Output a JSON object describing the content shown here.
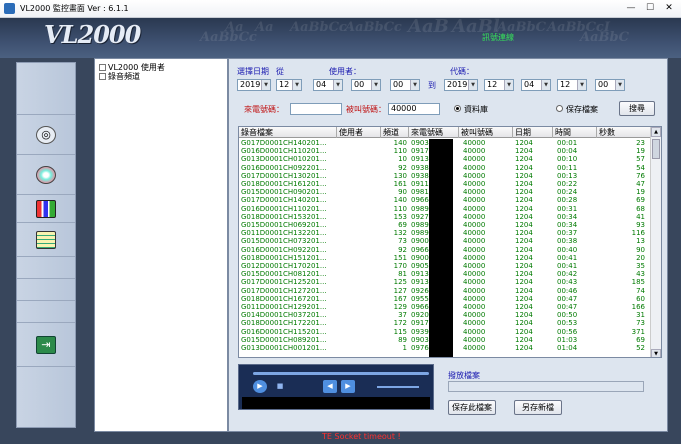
{
  "window": {
    "title": "VL2000 監控畫面 Ver : 6.1.1",
    "min": "—",
    "max": "☐",
    "close": "✕"
  },
  "header": {
    "logo": "VL2000",
    "watermark": [
      "Aa",
      "Aa",
      "AaBbCc",
      "AaBbCc",
      "AaB",
      "AaBl",
      "AaBbC",
      "AaBbCcI",
      "AaBbCc",
      "AaBbC"
    ],
    "status": "訊號連線"
  },
  "tree": {
    "items": [
      "VL2000 使用者",
      "錄音頻道"
    ]
  },
  "filters": {
    "date_label": "選擇日期",
    "from_label": "從",
    "user_label": "使用者：",
    "to_label": "到",
    "code_label": "代碼：",
    "from": {
      "year": "2019",
      "month": "12",
      "day": "04",
      "hour": "00",
      "min": "00"
    },
    "to": {
      "year": "2019",
      "month": "12",
      "day": "04",
      "hour": "12",
      "min": "00"
    },
    "caller_label": "來電號碼：",
    "callee_label": "被叫號碼：",
    "callee_value": "40000",
    "radio_db": "資料庫",
    "radio_file": "保存檔案",
    "search_btn": "搜尋"
  },
  "table": {
    "headers": [
      "錄音檔案",
      "使用者",
      "頻道",
      "來電號碼",
      "被叫號碼",
      "日期",
      "時間",
      "秒數"
    ],
    "rows": [
      [
        "G017D0001CH140201...",
        "",
        "140",
        "0903",
        "40000",
        "1204",
        "00:01",
        "23"
      ],
      [
        "G016D0001CH110201...",
        "",
        "110",
        "0917",
        "40000",
        "1204",
        "00:04",
        "19"
      ],
      [
        "G013D0001CH010201...",
        "",
        "10",
        "0913",
        "40000",
        "1204",
        "00:10",
        "57"
      ],
      [
        "G016D0001CH092201...",
        "",
        "92",
        "0938",
        "40000",
        "1204",
        "00:11",
        "54"
      ],
      [
        "G017D0001CH130201...",
        "",
        "130",
        "0938",
        "40000",
        "1204",
        "00:13",
        "76"
      ],
      [
        "G018D0001CH161201...",
        "",
        "161",
        "0911",
        "40000",
        "1204",
        "00:22",
        "47"
      ],
      [
        "G015D0001CH090201...",
        "",
        "90",
        "0981",
        "40000",
        "1204",
        "00:24",
        "19"
      ],
      [
        "G017D0001CH140201...",
        "",
        "140",
        "0966",
        "40000",
        "1204",
        "00:28",
        "69"
      ],
      [
        "G016D0001CH110201...",
        "",
        "110",
        "0989",
        "40000",
        "1204",
        "00:31",
        "68"
      ],
      [
        "G018D0001CH153201...",
        "",
        "153",
        "0927",
        "40000",
        "1204",
        "00:34",
        "41"
      ],
      [
        "G015D0001CH069201...",
        "",
        "69",
        "0989",
        "40000",
        "1204",
        "00:34",
        "93"
      ],
      [
        "G011D0001CH132201...",
        "",
        "132",
        "0989",
        "40000",
        "1204",
        "00:37",
        "116"
      ],
      [
        "G015D0001CH073201...",
        "",
        "73",
        "0900",
        "40000",
        "1204",
        "00:38",
        "13"
      ],
      [
        "G016D0001CH092201...",
        "",
        "92",
        "0966",
        "40000",
        "1204",
        "00:40",
        "90"
      ],
      [
        "G018D0001CH151201...",
        "",
        "151",
        "0900",
        "40000",
        "1204",
        "00:41",
        "20"
      ],
      [
        "G012D0001CH170201...",
        "",
        "170",
        "0905",
        "40000",
        "1204",
        "00:41",
        "35"
      ],
      [
        "G015D0001CH081201...",
        "",
        "81",
        "0913",
        "40000",
        "1204",
        "00:42",
        "43"
      ],
      [
        "G017D0001CH125201...",
        "",
        "125",
        "0913",
        "40000",
        "1204",
        "00:43",
        "185"
      ],
      [
        "G017D0001CH127201...",
        "",
        "127",
        "0926",
        "40000",
        "1204",
        "00:46",
        "74"
      ],
      [
        "G018D0001CH167201...",
        "",
        "167",
        "0955",
        "40000",
        "1204",
        "00:47",
        "60"
      ],
      [
        "G011D0001CH129201...",
        "",
        "129",
        "0966",
        "40000",
        "1204",
        "00:47",
        "166"
      ],
      [
        "G014D0001CH037201...",
        "",
        "37",
        "0920",
        "40000",
        "1204",
        "00:50",
        "31"
      ],
      [
        "G018D0001CH172201...",
        "",
        "172",
        "0917",
        "40000",
        "1204",
        "00:53",
        "73"
      ],
      [
        "G016D0001CH115201...",
        "",
        "115",
        "0939",
        "40000",
        "1204",
        "00:56",
        "371"
      ],
      [
        "G015D0001CH089201...",
        "",
        "89",
        "0903",
        "40000",
        "1204",
        "01:03",
        "69"
      ],
      [
        "G013D0001CH001201...",
        "",
        "1",
        "0976",
        "40000",
        "1204",
        "01:04",
        "52"
      ]
    ]
  },
  "player": {
    "play": "▶",
    "stop": "■",
    "prev": "◀",
    "next": "▶",
    "playfile_label": "撥放檔案",
    "save_btn": "保存此檔案",
    "saveas_btn": "另存新檔"
  },
  "status": {
    "bottom": "TE Socket timeout !"
  },
  "colors": {
    "frame": "#38465c",
    "header": "#3e5070",
    "row_text": "#007a00",
    "label": "#1a1ab0",
    "error": "#ff3030"
  }
}
